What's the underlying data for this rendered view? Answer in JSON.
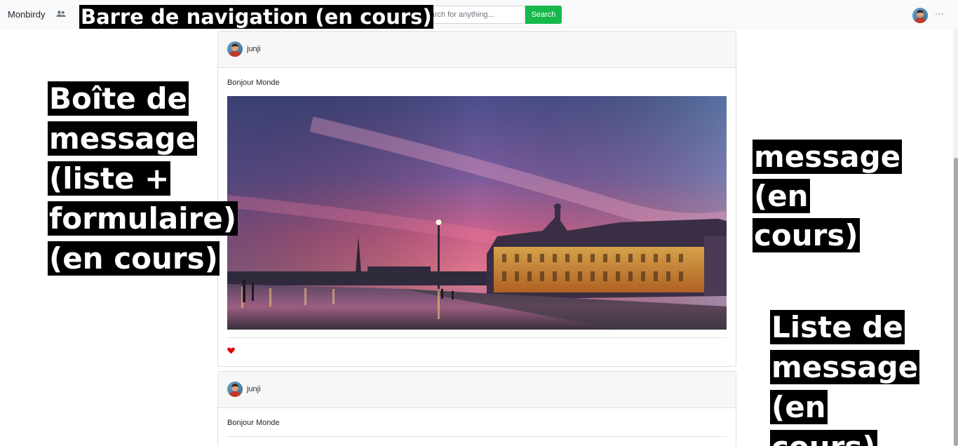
{
  "navbar": {
    "brand": "Monbirdy",
    "people_icon": "people-icon",
    "search": {
      "placeholder": "search for anything...",
      "value": "",
      "button_label": "Search"
    },
    "more_label": "···",
    "accent_color": "#16b84a"
  },
  "posts": [
    {
      "author": "junji",
      "message": "Bonjour Monde",
      "has_photo": true,
      "photo_description": "",
      "liked": true,
      "heart_color": "#e00000"
    },
    {
      "author": "junji",
      "message": "Bonjour Monde",
      "has_photo": false
    }
  ],
  "annotations": {
    "navbar": "Barre de navigation (en cours)",
    "message_box": "Boîte de message (liste + formulaire) (en cours)",
    "message": "message (en cours)",
    "message_list": "Liste de message (en cours)"
  }
}
